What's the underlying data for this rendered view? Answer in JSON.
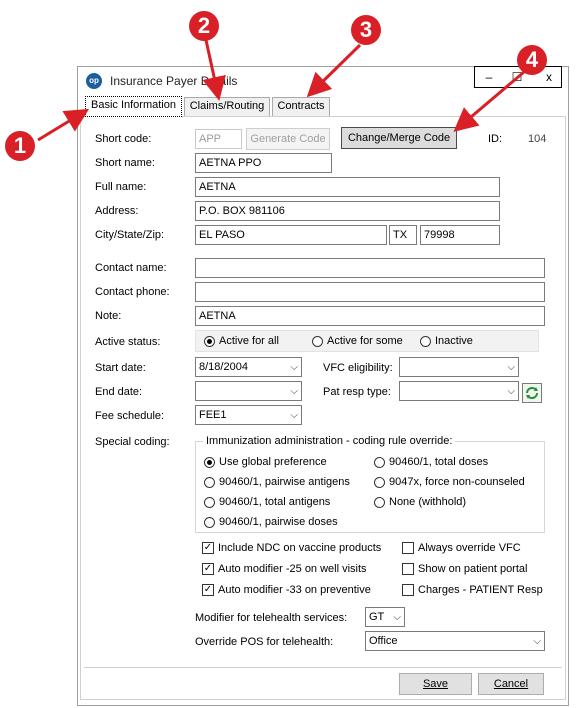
{
  "window": {
    "title": "Insurance Payer Details",
    "icon_text": "op",
    "controls": [
      "–",
      "☐",
      "x"
    ]
  },
  "tabs": [
    {
      "label": "Basic Information",
      "active": true
    },
    {
      "label": "Claims/Routing",
      "active": false
    },
    {
      "label": "Contracts",
      "active": false
    }
  ],
  "callouts": [
    "1",
    "2",
    "3",
    "4"
  ],
  "form": {
    "short_code": {
      "label": "Short code:",
      "value": "APP",
      "generate_label": "Generate Code",
      "change_label": "Change/Merge Code",
      "id_label": "ID:",
      "id_value": "104"
    },
    "short_name": {
      "label": "Short name:",
      "value": "AETNA PPO"
    },
    "full_name": {
      "label": "Full name:",
      "value": "AETNA"
    },
    "address": {
      "label": "Address:",
      "value": "P.O. BOX 981106"
    },
    "city_state_zip": {
      "label": "City/State/Zip:",
      "city": "EL PASO",
      "state": "TX",
      "zip": "79998"
    },
    "contact_name": {
      "label": "Contact name:",
      "value": ""
    },
    "contact_phone": {
      "label": "Contact phone:",
      "value": ""
    },
    "note": {
      "label": "Note:",
      "value": "AETNA"
    },
    "active_status": {
      "label": "Active status:",
      "options": [
        "Active for all",
        "Active for some",
        "Inactive"
      ],
      "selected": 0
    },
    "start_date": {
      "label": "Start date:",
      "value": "8/18/2004"
    },
    "end_date": {
      "label": "End date:",
      "value": ""
    },
    "fee_schedule": {
      "label": "Fee schedule:",
      "value": "FEE1"
    },
    "vfc_eligibility": {
      "label": "VFC eligibility:",
      "value": ""
    },
    "pat_resp_type": {
      "label": "Pat resp type:",
      "value": ""
    },
    "special_coding": {
      "label": "Special coding:",
      "group_title": "Immunization administration - coding rule override:",
      "options": [
        "Use global preference",
        "90460/1, pairwise antigens",
        "90460/1, total antigens",
        "90460/1, pairwise doses",
        "90460/1, total doses",
        "9047x, force non-counseled",
        "None (withhold)"
      ],
      "selected": 0
    },
    "checkboxes": [
      {
        "label": "Include NDC on vaccine products",
        "checked": true
      },
      {
        "label": "Auto modifier -25 on well visits",
        "checked": true
      },
      {
        "label": "Auto modifier -33 on preventive",
        "checked": true
      },
      {
        "label": "Always override VFC",
        "checked": false
      },
      {
        "label": "Show on patient portal",
        "checked": false
      },
      {
        "label": "Charges - PATIENT Resp",
        "checked": false
      }
    ],
    "telehealth_modifier": {
      "label": "Modifier for telehealth services:",
      "value": "GT"
    },
    "telehealth_pos": {
      "label": "Override POS for telehealth:",
      "value": "Office"
    }
  },
  "footer": {
    "save_label": "Save",
    "cancel_label": "Cancel"
  },
  "colors": {
    "callout": "#d92027",
    "arrow": "#d92027",
    "refresh_icon": "#2e8b3a"
  }
}
